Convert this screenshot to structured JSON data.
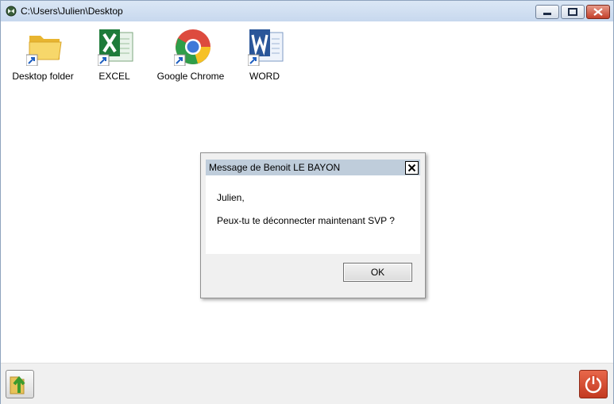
{
  "window": {
    "title": "C:\\Users\\Julien\\Desktop",
    "buttons": {
      "minimize": "minimize",
      "maximize": "maximize",
      "close": "close"
    }
  },
  "desktop": {
    "icons": [
      {
        "label": "Desktop folder",
        "icon": "folder-icon"
      },
      {
        "label": "EXCEL",
        "icon": "excel-icon"
      },
      {
        "label": "Google Chrome",
        "icon": "chrome-icon"
      },
      {
        "label": "WORD",
        "icon": "word-icon"
      }
    ]
  },
  "dialog": {
    "title": "Message de Benoit LE BAYON",
    "line1": "Julien,",
    "line2": "Peux-tu te déconnecter maintenant SVP ?",
    "ok_label": "OK"
  },
  "bottombar": {
    "left_button_icon": "folder-up-icon",
    "right_button_icon": "power-icon"
  },
  "colors": {
    "titlebar": "#c7d8ee",
    "dialog_title": "#bfcddb",
    "close_red": "#c4402a",
    "power_red": "#d9472b"
  }
}
